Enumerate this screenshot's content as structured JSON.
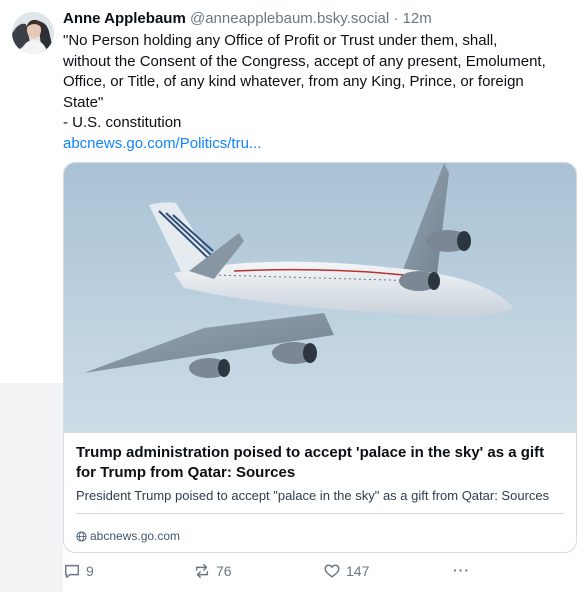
{
  "post": {
    "author": {
      "display_name": "Anne Applebaum",
      "handle": "@anneapplebaum.bsky.social",
      "separator": "·",
      "time": "12m"
    },
    "text_lines": [
      "\"No Person holding any Office of Profit or Trust under them, shall,",
      "without the Consent of the Congress, accept of any present, Emolument,",
      "Office, or Title, of any kind whatever, from any King, Prince, or foreign",
      "State\"",
      "- U.S. constitution"
    ],
    "link_text": "abcnews.go.com/Politics/tru...",
    "card": {
      "title": "Trump administration poised to accept 'palace in the sky' as a gift for Trump from Qatar: Sources",
      "description": "President Trump poised to accept \"palace in the sky\" as a gift from Qatar: Sources",
      "domain": "abcnews.go.com",
      "image_icon": "airplane-photo"
    },
    "actions": {
      "replies": "9",
      "reposts": "76",
      "likes": "147",
      "more_label": "···"
    }
  },
  "colors": {
    "link": "#1083fe",
    "muted_text": "#6b7785",
    "border": "#d4dbe2",
    "sky": "#b7cedd"
  }
}
